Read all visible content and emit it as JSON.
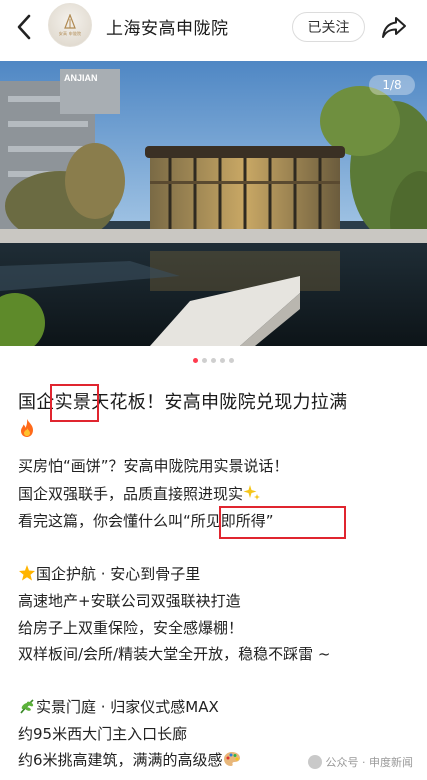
{
  "header": {
    "title": "上海安高申陇院",
    "follow_label": "已关注",
    "avatar_text": "安高 申陇院"
  },
  "photo": {
    "counter": "1/8",
    "logo_text": "ANJIAN"
  },
  "carousel": {
    "total": 5,
    "active": 0
  },
  "article": {
    "title": "国企实景天花板！安高申陇院兑现力拉满",
    "lines": [
      "买房怕“画饼”？安高申陇院用实景说话！",
      "国企双强联手，品质直接照进现实",
      "看完这篇，你会懂什么叫“所见即所得”",
      "国企护航 · 安心到骨子里",
      "高速地产+安联公司双强联袂打造",
      "给房子上双重保险，安全感爆棚！",
      "双样板间/会所/精装大堂全开放，稳稳不踩雷 ~",
      "实景门庭 · 归家仪式感MAX",
      "约95米西大门主入口长廊",
      "约6米挑高建筑，满满的高级感"
    ]
  },
  "watermark": {
    "text": "公众号 · 申度新闻"
  },
  "colors": {
    "accent": "#ff3b4f",
    "highlight_box": "#e0252f"
  }
}
